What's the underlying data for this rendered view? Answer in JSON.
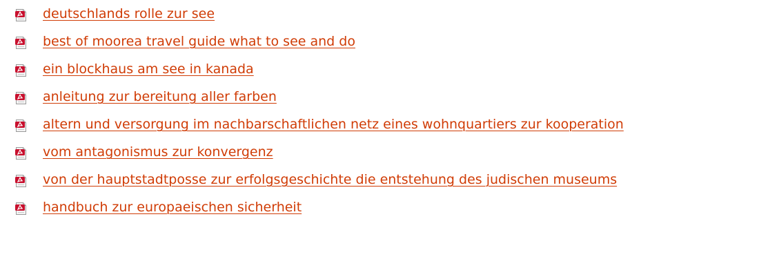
{
  "colors": {
    "link": "#d03c06",
    "icon_red": "#c8102e",
    "icon_page": "#f4f4f4",
    "icon_border": "#9a9a9a"
  },
  "file_icon": "pdf-file-icon",
  "files": [
    {
      "label": "deutschlands rolle zur see"
    },
    {
      "label": "best of moorea travel guide what to see and do"
    },
    {
      "label": "ein blockhaus am see in kanada"
    },
    {
      "label": "anleitung zur bereitung aller farben"
    },
    {
      "label": "altern und versorgung im nachbarschaftlichen netz eines wohnquartiers zur kooperation"
    },
    {
      "label": "vom antagonismus zur konvergenz"
    },
    {
      "label": "von der hauptstadtposse zur erfolgsgeschichte die entstehung des judischen museums"
    },
    {
      "label": "handbuch zur europaeischen sicherheit"
    }
  ]
}
